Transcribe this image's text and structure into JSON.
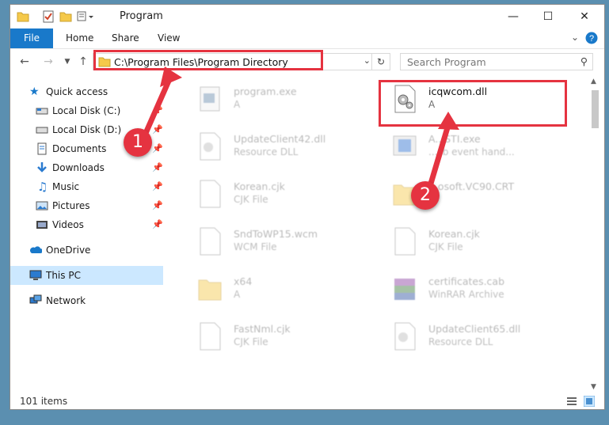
{
  "window": {
    "title": "Program"
  },
  "ribbon": {
    "file": "File",
    "home": "Home",
    "share": "Share",
    "view": "View"
  },
  "nav": {
    "address": "C:\\Program Files\\Program Directory",
    "search_placeholder": "Search Program"
  },
  "sidebar": {
    "items": [
      {
        "label": "Quick access"
      },
      {
        "label": "Local Disk (C:)"
      },
      {
        "label": "Local Disk (D:)"
      },
      {
        "label": "Documents"
      },
      {
        "label": "Downloads"
      },
      {
        "label": "Music"
      },
      {
        "label": "Pictures"
      },
      {
        "label": "Videos"
      },
      {
        "label": "OneDrive"
      },
      {
        "label": "This PC"
      },
      {
        "label": "Network"
      }
    ]
  },
  "files": [
    {
      "name": "program.exe",
      "type": "A"
    },
    {
      "name": "icqwcom.dll",
      "type": "A"
    },
    {
      "name": "UpdateClient42.dll",
      "type": "Resource DLL"
    },
    {
      "name": "A...STI.exe",
      "type": "...sb event hand..."
    },
    {
      "name": "Korean.cjk",
      "type": "CJK File"
    },
    {
      "name": "...osoft.VC90.CRT",
      "type": ""
    },
    {
      "name": "SndToWP15.wcm",
      "type": "WCM File"
    },
    {
      "name": "Korean.cjk",
      "type": "CJK File"
    },
    {
      "name": "x64",
      "type": "A"
    },
    {
      "name": "certificates.cab",
      "type": "WinRAR Archive"
    },
    {
      "name": "FastNml.cjk",
      "type": "CJK File"
    },
    {
      "name": "UpdateClient65.dll",
      "type": "Resource DLL"
    }
  ],
  "status": {
    "count": "101 items"
  },
  "annotations": {
    "step1": "1",
    "step2": "2",
    "color": "#e53340"
  },
  "colors": {
    "accent": "#1979ca",
    "selected": "#cce8ff"
  }
}
